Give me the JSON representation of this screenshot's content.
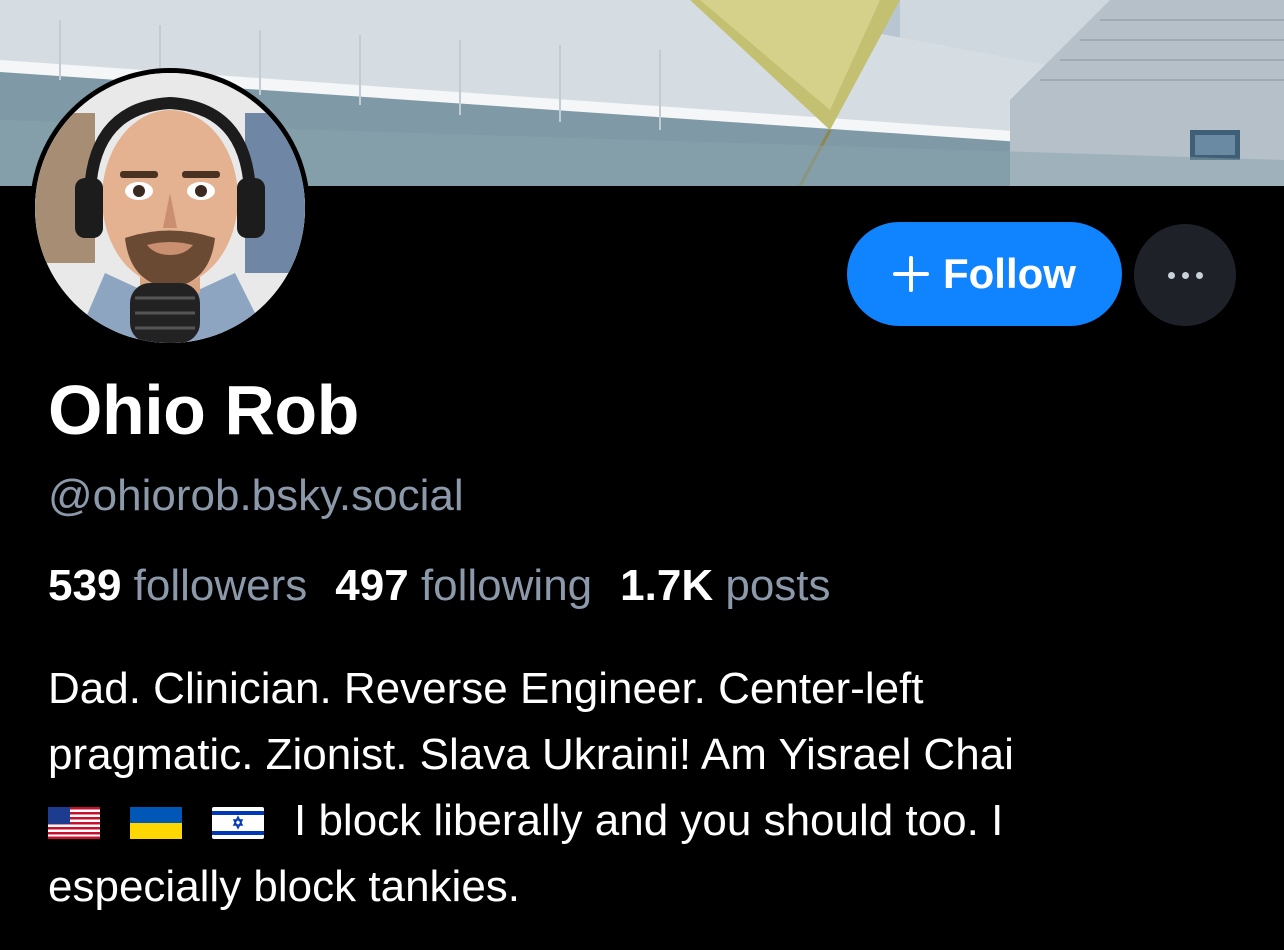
{
  "profile": {
    "display_name": "Ohio Rob",
    "handle": "@ohiorob.bsky.social",
    "stats": {
      "followers_count": "539",
      "followers_label": "followers",
      "following_count": "497",
      "following_label": "following",
      "posts_count": "1.7K",
      "posts_label": "posts"
    },
    "bio": {
      "line1": "Dad. Clinician. Reverse Engineer. Center-left",
      "line2": "pragmatic. Zionist. Slava Ukraini! Am Yisrael Chai",
      "line3_text": "I block liberally and you should too. I",
      "line4": "especially block tankies.",
      "flags": [
        "us-flag-icon",
        "ukraine-flag-icon",
        "israel-flag-icon"
      ]
    }
  },
  "actions": {
    "follow_label": "Follow",
    "follow_icon": "plus-icon",
    "more_icon": "more-options-icon"
  },
  "colors": {
    "background": "#000000",
    "accent": "#1083fe",
    "muted_text": "#8c99ab",
    "more_button_bg": "#1e2228"
  }
}
